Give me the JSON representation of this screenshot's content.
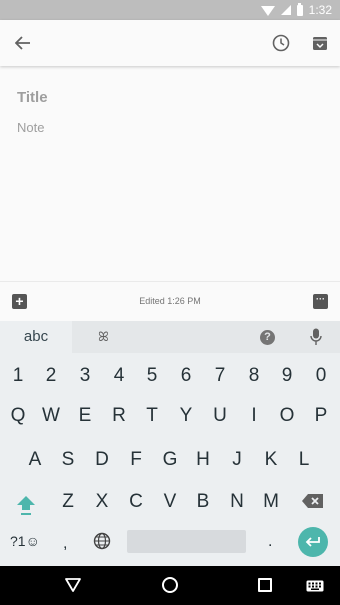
{
  "status_bar": {
    "time": "1:32"
  },
  "app_bar": {
    "back_icon": "arrow-back-icon",
    "reminder_icon": "clock-icon",
    "archive_icon": "archive-icon"
  },
  "editor": {
    "title_placeholder": "Title",
    "note_placeholder": "Note"
  },
  "bottom_bar": {
    "add_icon": "add-box-icon",
    "edited_text": "Edited 1:26 PM",
    "more_icon": "more-icon"
  },
  "keyboard": {
    "tab_label": "abc",
    "language_glyph": "ꕤ",
    "help_label": "?",
    "number_row": [
      "1",
      "2",
      "3",
      "4",
      "5",
      "6",
      "7",
      "8",
      "9",
      "0"
    ],
    "row1": [
      "Q",
      "W",
      "E",
      "R",
      "T",
      "Y",
      "U",
      "I",
      "O",
      "P"
    ],
    "row2": [
      "A",
      "S",
      "D",
      "F",
      "G",
      "H",
      "J",
      "K",
      "L"
    ],
    "row3": [
      "Z",
      "X",
      "C",
      "V",
      "B",
      "N",
      "M"
    ],
    "symbols_label": "?1☺",
    "comma": ",",
    "period": ".",
    "accent_color": "#4db6ac"
  },
  "nav_bar": {
    "back_icon": "nav-back-icon",
    "home_icon": "nav-home-icon",
    "recent_icon": "nav-recent-icon",
    "keyboard_icon": "nav-keyboard-icon"
  }
}
